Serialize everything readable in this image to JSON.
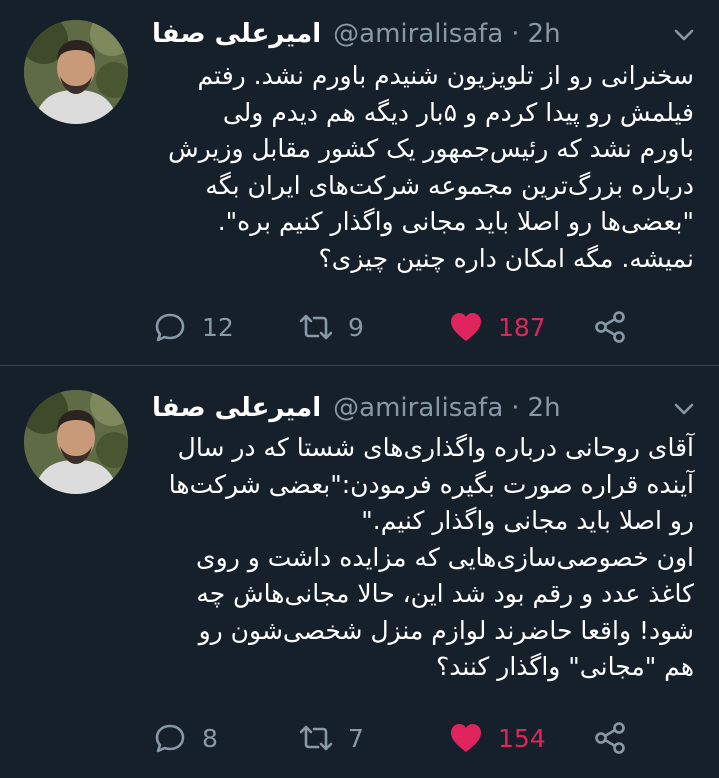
{
  "colors": {
    "background": "#15202b",
    "text": "#ffffff",
    "secondary": "#8899a6",
    "like": "#e0245e",
    "divider": "#38444d"
  },
  "tweets": [
    {
      "display_name": "امیرعلی صفا",
      "handle": "@amiralisafa",
      "separator": "·",
      "time": "2h",
      "lines": [
        "سخنرانی رو از تلویزیون شنیدم باورم نشد. رفتم",
        "فیلمش رو پیدا کردم و ۵بار دیگه هم دیدم ولی",
        "باورم نشد که رئیس‌جمهور یک کشور مقابل وزیرش",
        "درباره بزرگ‌ترین مجموعه شرکت‌های ایران بگه",
        "\"بعضی‌ها رو اصلا باید مجانی واگذار کنیم بره\".",
        "نمیشه. مگه امکان داره چنین چیزی؟"
      ],
      "replies": "12",
      "retweets": "9",
      "likes": "187",
      "liked": true
    },
    {
      "display_name": "امیرعلی صفا",
      "handle": "@amiralisafa",
      "separator": "·",
      "time": "2h",
      "lines": [
        "آقای روحانی درباره واگذاری‌های شستا که در سال",
        "آینده قراره صورت بگیره فرمودن:\"بعضی شرکت‌ها",
        "رو اصلا باید مجانی واگذار کنیم.\"",
        "اون خصوصی‌سازی‌هایی که مزایده داشت و روی",
        "کاغذ عدد و رقم بود شد این، حالا مجانی‌هاش چه",
        "شود! واقعا حاضرند لوازم منزل شخصی‌شون رو",
        "هم \"مجانی\" واگذار کنند؟"
      ],
      "replies": "8",
      "retweets": "7",
      "likes": "154",
      "liked": true
    }
  ],
  "icons": {
    "avatar": "profile-photo",
    "menu": "chevron-down-icon",
    "reply": "reply-icon",
    "retweet": "retweet-icon",
    "like": "heart-icon",
    "share": "share-icon"
  }
}
